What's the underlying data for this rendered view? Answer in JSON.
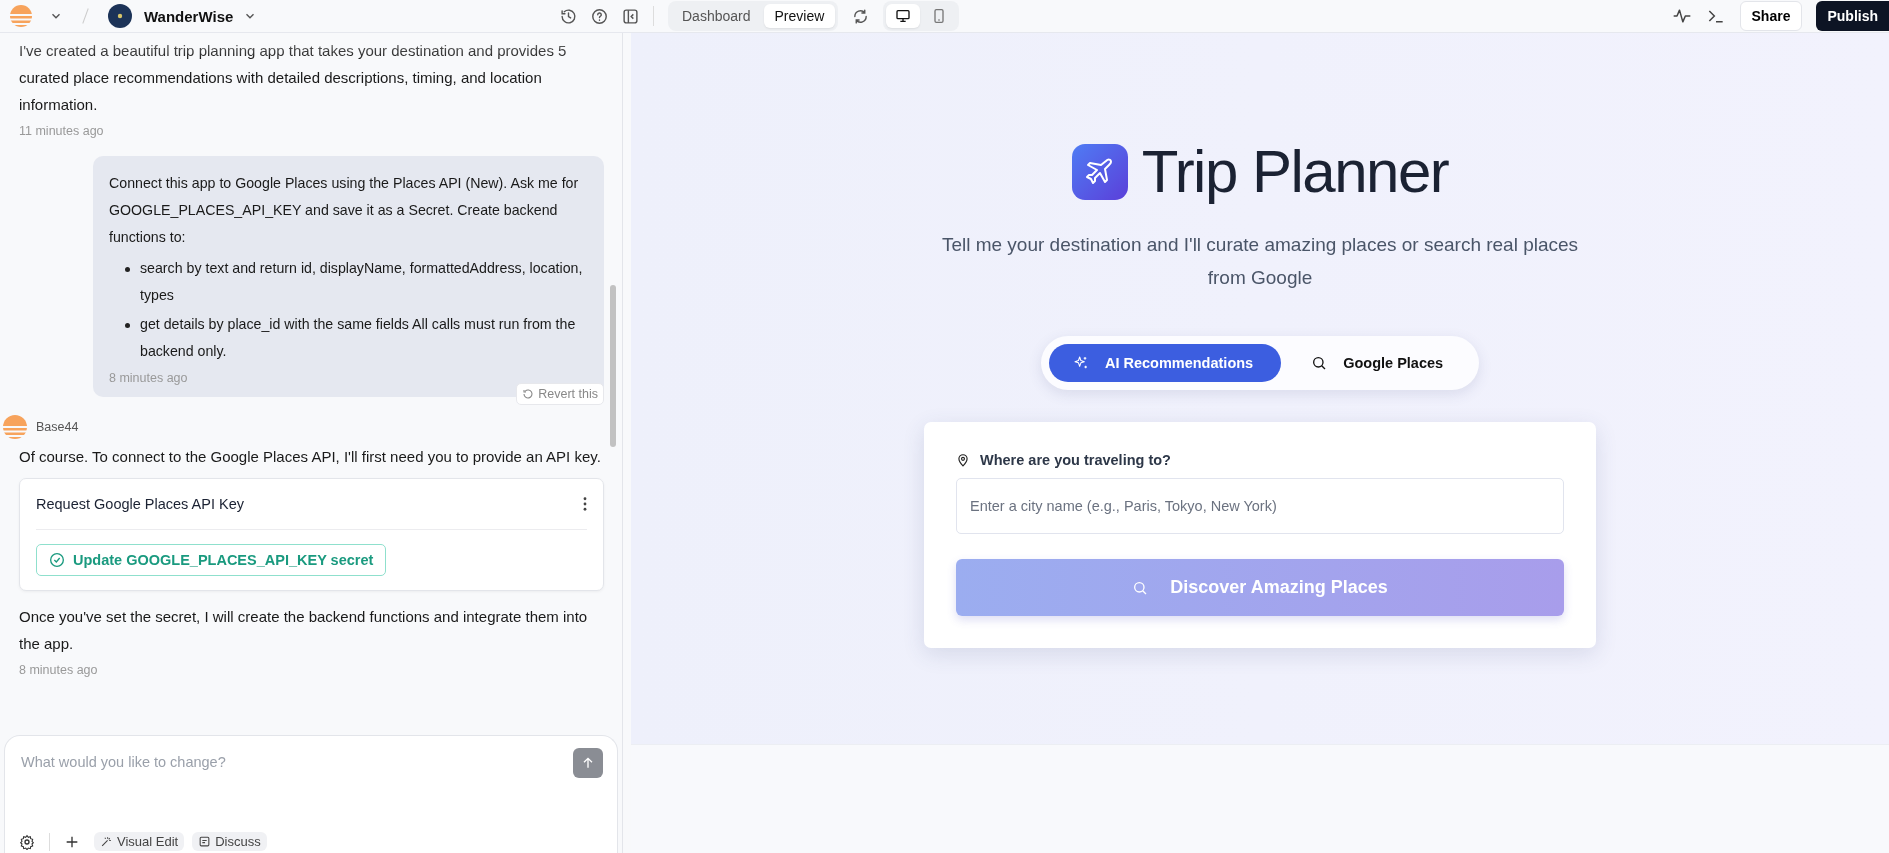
{
  "topbar": {
    "project_name": "WanderWise",
    "mode_tabs": [
      {
        "label": "Dashboard",
        "selected": false
      },
      {
        "label": "Preview",
        "selected": true
      }
    ],
    "device_toggle": [
      {
        "kind": "desktop",
        "selected": true
      },
      {
        "kind": "mobile",
        "selected": false
      }
    ],
    "share_button": "Share",
    "publish_button": "Publish"
  },
  "chat": {
    "intro": {
      "text": "I've created a beautiful trip planning app that takes your destination and provides 5 curated place recommendations with detailed descriptions, timing, and location information.",
      "time": "11 minutes ago"
    },
    "user_message": {
      "text": "Connect this app to Google Places using the Places API (New). Ask me for GOOGLE_PLACES_API_KEY and save it as a Secret. Create backend functions to:",
      "bullets": [
        "search by text and return id, displayName, formattedAddress, location, types",
        "get details by place_id with the same fields All calls must run from the backend only."
      ],
      "time": "8 minutes ago",
      "revert_button": "Revert this"
    },
    "assistant": {
      "name": "Base44",
      "text": "Of course. To connect to the Google Places API, I'll first need you to provide an API key.",
      "request_card": {
        "title": "Request Google Places API Key",
        "action": "Update GOOGLE_PLACES_API_KEY secret"
      },
      "followup": "Once you've set the secret, I will create the backend functions and integrate them into the app.",
      "time": "8 minutes ago"
    }
  },
  "composer": {
    "placeholder": "What would you like to change?",
    "tools": [
      "Visual Edit",
      "Discuss"
    ]
  },
  "preview": {
    "title": "Trip Planner",
    "subtitle": "Tell me your destination and I'll curate amazing places or search real places from Google",
    "search_modes": [
      {
        "kind": "ai",
        "label": "AI Recommendations",
        "selected": true
      },
      {
        "kind": "google",
        "label": "Google Places",
        "selected": false
      }
    ],
    "form": {
      "label": "Where are you traveling to?",
      "placeholder": "Enter a city name (e.g., Paris, Tokyo, New York)",
      "submit": {
        "label": "Discover Amazing Places",
        "disabled": true
      }
    }
  }
}
